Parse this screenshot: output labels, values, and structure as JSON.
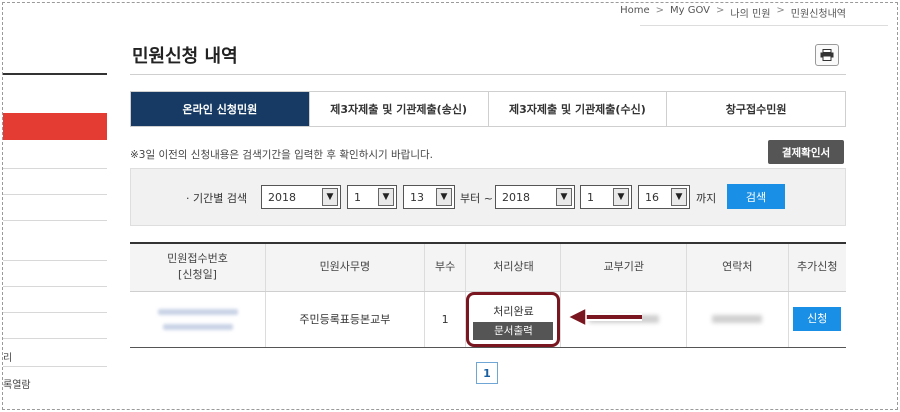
{
  "breadcrumb": [
    "Home",
    "My GOV",
    "나의 민원",
    "민원신청내역"
  ],
  "sidebar_fragments": [
    "리",
    "록열람"
  ],
  "page_title": "민원신청 내역",
  "print_icon": "printer-icon",
  "tabs": [
    {
      "label": "온라인 신청민원",
      "active": true
    },
    {
      "label": "제3자제출 및 기관제출(송신)",
      "active": false
    },
    {
      "label": "제3자제출 및 기관제출(수신)",
      "active": false
    },
    {
      "label": "창구접수민원",
      "active": false
    }
  ],
  "notice": "※3일 이전의 신청내용은 검색기간을 입력한 후 확인하시기 바랍니다.",
  "confirm_button": "결제확인서",
  "search": {
    "label": "· 기간별 검색",
    "from_year": "2018",
    "from_month": "1",
    "from_day": "13",
    "from_text": "부터 ~",
    "to_year": "2018",
    "to_month": "1",
    "to_day": "16",
    "to_text": "까지",
    "button": "검색"
  },
  "table": {
    "headers": [
      "민원접수번호",
      "[신청일]",
      "민원사무명",
      "부수",
      "처리상태",
      "교부기관",
      "연락처",
      "추가신청"
    ],
    "row": {
      "office_name": "주민등록표등본교부",
      "copies": "1",
      "status": "처리완료",
      "print_button": "문서출력",
      "apply_button": "신청"
    }
  },
  "pagination": {
    "current_page": "1"
  },
  "colors": {
    "tab_active": "#163a63",
    "accent_blue": "#1a8fe6",
    "sidebar_red": "#e43b33",
    "highlight_box": "#7a1620"
  }
}
